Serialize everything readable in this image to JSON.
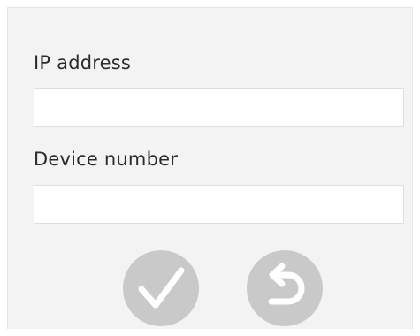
{
  "form": {
    "ip_address": {
      "label": "IP address",
      "value": "",
      "placeholder": ""
    },
    "device_number": {
      "label": "Device number",
      "value": "",
      "placeholder": ""
    }
  },
  "actions": {
    "confirm": {
      "icon": "checkmark-icon"
    },
    "back": {
      "icon": "undo-arrow-icon"
    }
  },
  "colors": {
    "panel_background": "#f3f3f3",
    "field_background": "#ffffff",
    "button_circle": "#c9c9c9",
    "button_glyph": "#ffffff",
    "label_text": "#2b2b2b"
  }
}
